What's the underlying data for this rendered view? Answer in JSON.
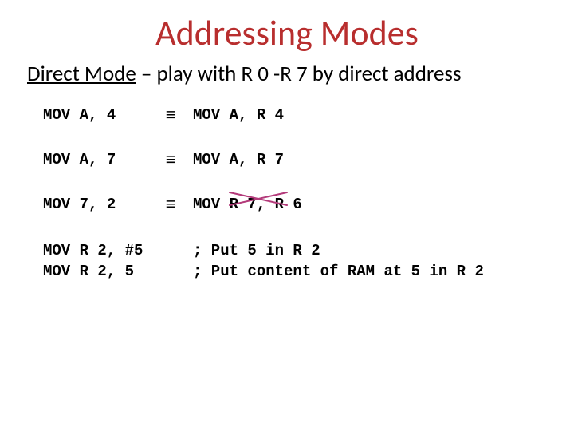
{
  "title": "Addressing Modes",
  "subhead": {
    "underlined": "Direct Mode",
    "rest": " – play with R 0 -R 7 by direct address"
  },
  "equiv_symbol": "≡",
  "rows": [
    {
      "lhs": "MOV A, 4",
      "rhs": "MOV A, R 4",
      "crossed": false
    },
    {
      "lhs": "MOV A, 7",
      "rhs": "MOV A, R 7",
      "crossed": false
    },
    {
      "lhs": "MOV 7, 2",
      "rhs": "MOV R 7, R 6",
      "crossed": true
    }
  ],
  "block2": [
    {
      "code": "MOV R 2, #5",
      "comment": "; Put 5 in R 2"
    },
    {
      "code": "MOV R 2, 5",
      "comment": "; Put content of RAM at 5 in R 2"
    }
  ]
}
